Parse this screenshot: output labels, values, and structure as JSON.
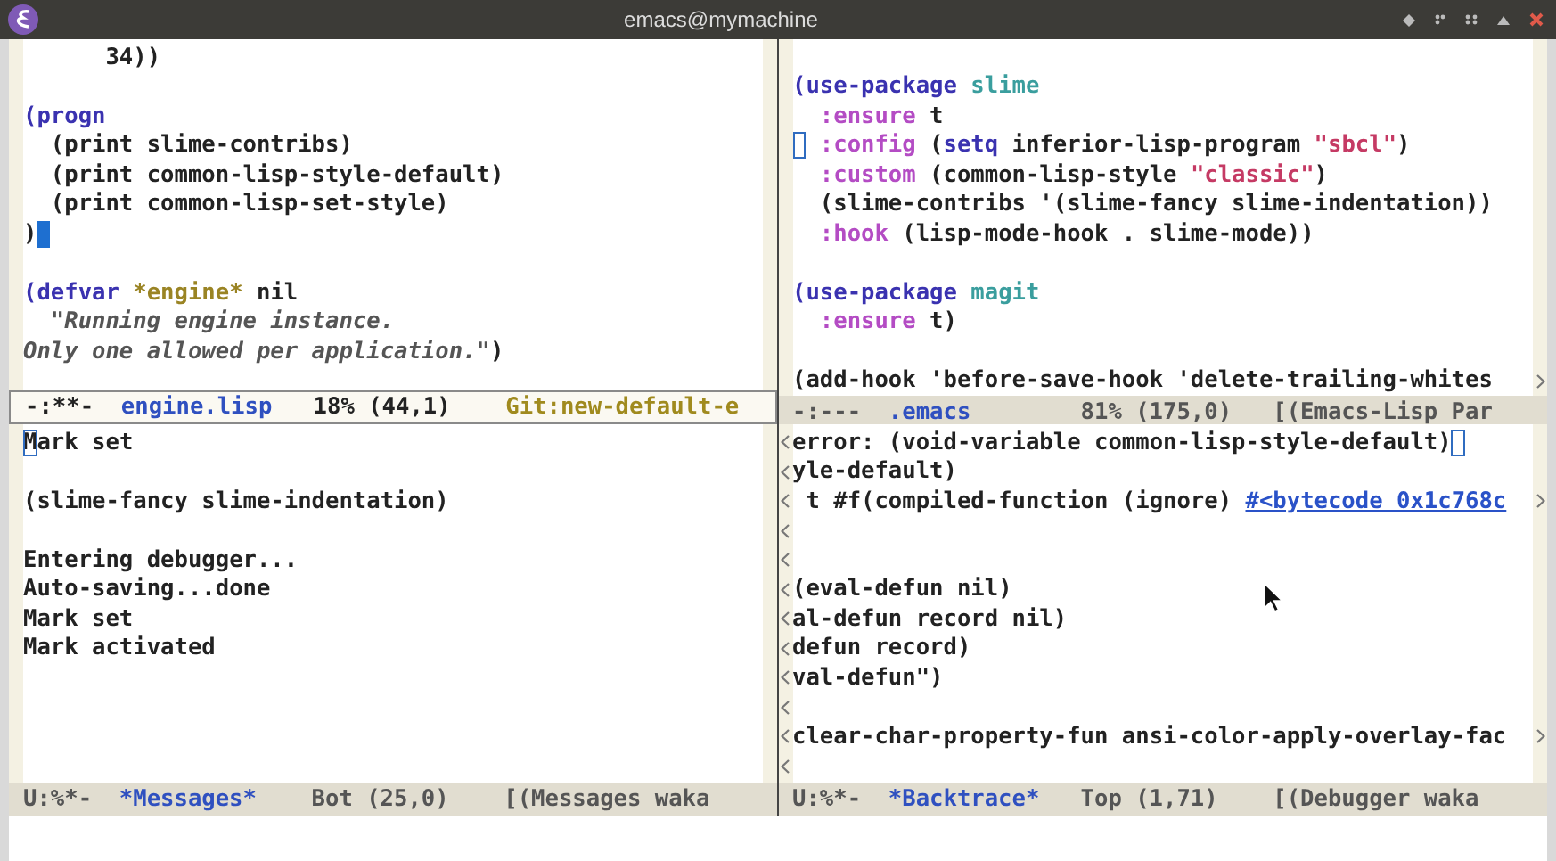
{
  "window": {
    "title": "emacs@mymachine"
  },
  "panes": [
    {
      "lines": [
        {
          "kind": "code",
          "segments": [
            {
              "text": "      34))",
              "kind": "plain"
            }
          ]
        },
        {
          "kind": "blank"
        },
        {
          "kind": "code",
          "segments": [
            {
              "text": "(progn",
              "kind": "keyword"
            }
          ]
        },
        {
          "kind": "code",
          "segments": [
            {
              "text": "  (print slime-contribs)",
              "kind": "plain"
            }
          ]
        },
        {
          "kind": "code",
          "segments": [
            {
              "text": "  (print common-lisp-style-default)",
              "kind": "plain"
            }
          ]
        },
        {
          "kind": "code",
          "segments": [
            {
              "text": "  (print common-lisp-set-style)",
              "kind": "plain"
            }
          ]
        },
        {
          "kind": "code",
          "segments": [
            {
              "text": ")",
              "kind": "plain"
            }
          ],
          "cursor_at_end": true,
          "cursor_filled": true
        },
        {
          "kind": "blank"
        },
        {
          "kind": "code",
          "segments": [
            {
              "text": "(defvar",
              "kind": "keyword"
            },
            {
              "text": " *engine*",
              "kind": "variable"
            },
            {
              "text": " nil",
              "kind": "plain"
            }
          ]
        },
        {
          "kind": "code",
          "segments": [
            {
              "text": "  \"Running engine instance.",
              "kind": "doc"
            }
          ]
        },
        {
          "kind": "code",
          "segments": [
            {
              "text": "Only one allowed per application.\"",
              "kind": "doc"
            },
            {
              "text": ")",
              "kind": "plain"
            }
          ]
        }
      ],
      "mode_line": {
        "active": true,
        "segments": [
          {
            "text": "-:**-",
            "kind": "status"
          },
          {
            "text": "engine.lisp",
            "kind": "buffer"
          },
          {
            "text": "18% (44,1)",
            "kind": "position"
          },
          {
            "text": "Git:new-default-e",
            "kind": "vc"
          }
        ]
      }
    },
    {
      "lines": [
        {
          "kind": "blank"
        },
        {
          "kind": "code",
          "segments": [
            {
              "text": "(use-package",
              "kind": "keyword"
            },
            {
              "text": " slime",
              "kind": "name"
            }
          ]
        },
        {
          "kind": "code",
          "segments": [
            {
              "text": "  :ensure",
              "kind": "property"
            },
            {
              "text": " t",
              "kind": "plain"
            }
          ]
        },
        {
          "kind": "code",
          "cursor_at_start": true,
          "cursor_filled": false,
          "segments": [
            {
              "text": " :config",
              "kind": "property"
            },
            {
              "text": " (",
              "kind": "plain"
            },
            {
              "text": "setq",
              "kind": "keyword"
            },
            {
              "text": " inferior-lisp-program ",
              "kind": "plain"
            },
            {
              "text": "\"sbcl\"",
              "kind": "string"
            },
            {
              "text": ")",
              "kind": "plain"
            }
          ]
        },
        {
          "kind": "code",
          "segments": [
            {
              "text": "  :custom",
              "kind": "property"
            },
            {
              "text": " (common-lisp-style ",
              "kind": "plain"
            },
            {
              "text": "\"classic\"",
              "kind": "string"
            },
            {
              "text": ")",
              "kind": "plain"
            }
          ]
        },
        {
          "kind": "code",
          "segments": [
            {
              "text": "  (slime-contribs '(slime-fancy slime-indentation))",
              "kind": "plain"
            }
          ]
        },
        {
          "kind": "code",
          "segments": [
            {
              "text": "  :hook",
              "kind": "property"
            },
            {
              "text": " (lisp-mode-hook . slime-mode))",
              "kind": "plain"
            }
          ]
        },
        {
          "kind": "blank"
        },
        {
          "kind": "code",
          "segments": [
            {
              "text": "(use-package",
              "kind": "keyword"
            },
            {
              "text": " magit",
              "kind": "name"
            }
          ]
        },
        {
          "kind": "code",
          "segments": [
            {
              "text": "  :ensure",
              "kind": "property"
            },
            {
              "text": " t)",
              "kind": "plain"
            }
          ]
        },
        {
          "kind": "blank"
        },
        {
          "kind": "code",
          "segments": [
            {
              "text": "(add-hook 'before-save-hook 'delete-trailing-whites",
              "kind": "plain"
            }
          ],
          "fringe_right": true
        }
      ],
      "mode_line": {
        "active": false,
        "segments": [
          {
            "text": "-:---",
            "kind": "status"
          },
          {
            "text": ".emacs",
            "kind": "buffer"
          },
          {
            "text": "81% (175,0)",
            "kind": "position"
          },
          {
            "text": "[(Emacs-Lisp Par",
            "kind": "mode"
          }
        ]
      }
    },
    {
      "lines": [
        {
          "kind": "code",
          "segments": [
            {
              "text": "M",
              "kind": "cursor-box"
            },
            {
              "text": "ark set",
              "kind": "plain"
            }
          ]
        },
        {
          "kind": "blank"
        },
        {
          "kind": "code",
          "segments": [
            {
              "text": "(slime-fancy slime-indentation)",
              "kind": "plain"
            }
          ]
        },
        {
          "kind": "blank"
        },
        {
          "kind": "code",
          "segments": [
            {
              "text": "Entering debugger...",
              "kind": "plain"
            }
          ]
        },
        {
          "kind": "code",
          "segments": [
            {
              "text": "Auto-saving...done",
              "kind": "plain"
            }
          ]
        },
        {
          "kind": "code",
          "segments": [
            {
              "text": "Mark set",
              "kind": "plain"
            }
          ]
        },
        {
          "kind": "code",
          "segments": [
            {
              "text": "Mark activated",
              "kind": "plain"
            }
          ]
        }
      ],
      "mode_line": {
        "active": false,
        "segments": [
          {
            "text": "U:%*-",
            "kind": "status"
          },
          {
            "text": "*Messages*",
            "kind": "buffer"
          },
          {
            "text": "Bot (25,0)",
            "kind": "position"
          },
          {
            "text": "[(Messages waka",
            "kind": "mode"
          }
        ]
      }
    },
    {
      "lines": [
        {
          "kind": "code",
          "segments": [
            {
              "text": "error: (void-variable common-lisp-style-default)",
              "kind": "plain"
            }
          ],
          "cursor_at_end": true,
          "cursor_filled": false,
          "fringe_left": true
        },
        {
          "kind": "code",
          "segments": [
            {
              "text": "yle-default)",
              "kind": "plain"
            }
          ],
          "fringe_left": true
        },
        {
          "kind": "code",
          "segments": [
            {
              "text": " t #f(compiled-function (ignore) ",
              "kind": "plain"
            },
            {
              "text": "#<bytecode 0x1c768c",
              "kind": "link"
            }
          ],
          "fringe_left": true,
          "fringe_right": true
        },
        {
          "kind": "blank",
          "fringe_left": true
        },
        {
          "kind": "blank",
          "fringe_left": true
        },
        {
          "kind": "code",
          "segments": [
            {
              "text": "(eval-defun nil)",
              "kind": "plain"
            }
          ],
          "fringe_left": true
        },
        {
          "kind": "code",
          "segments": [
            {
              "text": "al-defun record nil)",
              "kind": "plain"
            }
          ],
          "fringe_left": true
        },
        {
          "kind": "code",
          "segments": [
            {
              "text": "defun record)",
              "kind": "plain"
            }
          ],
          "fringe_left": true
        },
        {
          "kind": "code",
          "segments": [
            {
              "text": "val-defun\")",
              "kind": "plain"
            }
          ],
          "fringe_left": true
        },
        {
          "kind": "blank",
          "fringe_left": true
        },
        {
          "kind": "code",
          "segments": [
            {
              "text": "clear-char-property-fun ansi-color-apply-overlay-fac",
              "kind": "plain"
            }
          ],
          "fringe_left": true,
          "fringe_right": true
        },
        {
          "kind": "blank",
          "fringe_left": true
        }
      ],
      "mode_line": {
        "active": false,
        "segments": [
          {
            "text": "U:%*-",
            "kind": "status"
          },
          {
            "text": "*Backtrace*",
            "kind": "buffer"
          },
          {
            "text": "Top (1,71)",
            "kind": "position"
          },
          {
            "text": "[(Debugger waka",
            "kind": "mode"
          }
        ]
      }
    }
  ]
}
